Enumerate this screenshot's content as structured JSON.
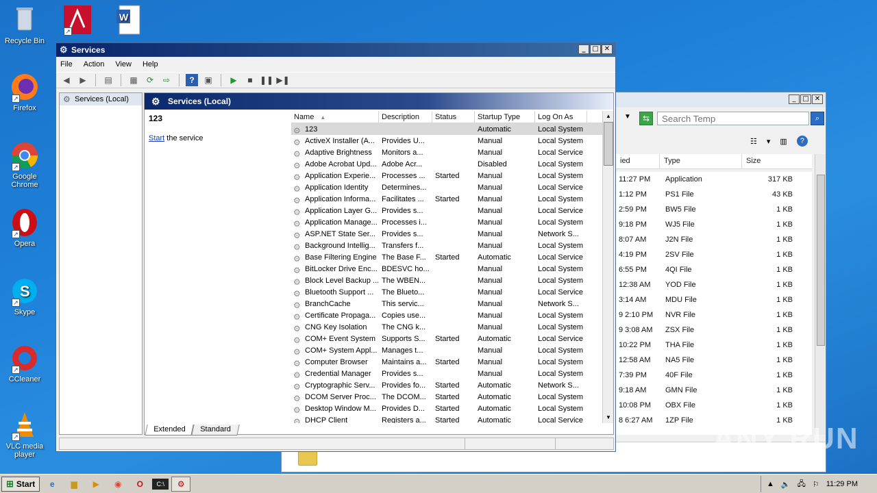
{
  "desktop": {
    "icons": [
      {
        "label": "Recycle Bin"
      },
      {
        "label": ""
      },
      {
        "label": ""
      },
      {
        "label": "Firefox"
      },
      {
        "label": "Google Chrome"
      },
      {
        "label": "Opera"
      },
      {
        "label": "Skype"
      },
      {
        "label": "CCleaner"
      },
      {
        "label": "VLC media player"
      }
    ]
  },
  "explorer": {
    "search_placeholder": "Search Temp",
    "columns": [
      "ied",
      "Type",
      "Size"
    ],
    "rows": [
      {
        "d": "11:27 PM",
        "t": "Application",
        "s": "317 KB"
      },
      {
        "d": "1:12 PM",
        "t": "PS1 File",
        "s": "43 KB"
      },
      {
        "d": "2:59 PM",
        "t": "BW5 File",
        "s": "1 KB"
      },
      {
        "d": "9:18 PM",
        "t": "WJ5 File",
        "s": "1 KB"
      },
      {
        "d": "8:07 AM",
        "t": "J2N File",
        "s": "1 KB"
      },
      {
        "d": "4:19 PM",
        "t": "2SV File",
        "s": "1 KB"
      },
      {
        "d": "6:55 PM",
        "t": "4QI File",
        "s": "1 KB"
      },
      {
        "d": "12:38 AM",
        "t": "YOD File",
        "s": "1 KB"
      },
      {
        "d": "3:14 AM",
        "t": "MDU File",
        "s": "1 KB"
      },
      {
        "d": "9 2:10 PM",
        "t": "NVR File",
        "s": "1 KB"
      },
      {
        "d": "9 3:08 AM",
        "t": "ZSX File",
        "s": "1 KB"
      },
      {
        "d": "10:22 PM",
        "t": "THA File",
        "s": "1 KB"
      },
      {
        "d": "12:58 AM",
        "t": "NA5 File",
        "s": "1 KB"
      },
      {
        "d": "7:39 PM",
        "t": "40F File",
        "s": "1 KB"
      },
      {
        "d": "9:18 AM",
        "t": "GMN File",
        "s": "1 KB"
      },
      {
        "d": "10:08 PM",
        "t": "OBX File",
        "s": "1 KB"
      },
      {
        "d": "8 6:27 AM",
        "t": "1ZP File",
        "s": "1 KB"
      }
    ]
  },
  "services": {
    "title": "Services",
    "menu": [
      "File",
      "Action",
      "View",
      "Help"
    ],
    "tree_node": "Services (Local)",
    "header": "Services (Local)",
    "selected_name": "123",
    "start_link": "Start",
    "start_rest": " the service",
    "columns": [
      "Name",
      "Description",
      "Status",
      "Startup Type",
      "Log On As"
    ],
    "rows": [
      [
        "123",
        "",
        "",
        "Automatic",
        "Local System"
      ],
      [
        "ActiveX Installer (A...",
        "Provides U...",
        "",
        "Manual",
        "Local System"
      ],
      [
        "Adaptive Brightness",
        "Monitors a...",
        "",
        "Manual",
        "Local Service"
      ],
      [
        "Adobe Acrobat Upd...",
        "Adobe Acr...",
        "",
        "Disabled",
        "Local System"
      ],
      [
        "Application Experie...",
        "Processes ...",
        "Started",
        "Manual",
        "Local System"
      ],
      [
        "Application Identity",
        "Determines...",
        "",
        "Manual",
        "Local Service"
      ],
      [
        "Application Informa...",
        "Facilitates ...",
        "Started",
        "Manual",
        "Local System"
      ],
      [
        "Application Layer G...",
        "Provides s...",
        "",
        "Manual",
        "Local Service"
      ],
      [
        "Application Manage...",
        "Processes i...",
        "",
        "Manual",
        "Local System"
      ],
      [
        "ASP.NET State Ser...",
        "Provides s...",
        "",
        "Manual",
        "Network S..."
      ],
      [
        "Background Intellig...",
        "Transfers f...",
        "",
        "Manual",
        "Local System"
      ],
      [
        "Base Filtering Engine",
        "The Base F...",
        "Started",
        "Automatic",
        "Local Service"
      ],
      [
        "BitLocker Drive Enc...",
        "BDESVC ho...",
        "",
        "Manual",
        "Local System"
      ],
      [
        "Block Level Backup ...",
        "The WBEN...",
        "",
        "Manual",
        "Local System"
      ],
      [
        "Bluetooth Support ...",
        "The Blueto...",
        "",
        "Manual",
        "Local Service"
      ],
      [
        "BranchCache",
        "This servic...",
        "",
        "Manual",
        "Network S..."
      ],
      [
        "Certificate Propaga...",
        "Copies use...",
        "",
        "Manual",
        "Local System"
      ],
      [
        "CNG Key Isolation",
        "The CNG k...",
        "",
        "Manual",
        "Local System"
      ],
      [
        "COM+ Event System",
        "Supports S...",
        "Started",
        "Automatic",
        "Local Service"
      ],
      [
        "COM+ System Appl...",
        "Manages t...",
        "",
        "Manual",
        "Local System"
      ],
      [
        "Computer Browser",
        "Maintains a...",
        "Started",
        "Manual",
        "Local System"
      ],
      [
        "Credential Manager",
        "Provides s...",
        "",
        "Manual",
        "Local System"
      ],
      [
        "Cryptographic Serv...",
        "Provides fo...",
        "Started",
        "Automatic",
        "Network S..."
      ],
      [
        "DCOM Server Proc...",
        "The DCOM...",
        "Started",
        "Automatic",
        "Local System"
      ],
      [
        "Desktop Window M...",
        "Provides D...",
        "Started",
        "Automatic",
        "Local System"
      ],
      [
        "DHCP Client",
        "Registers a...",
        "Started",
        "Automatic",
        "Local Service"
      ]
    ],
    "tabs": [
      "Extended",
      "Standard"
    ]
  },
  "taskbar": {
    "start": "Start",
    "clock": "11:29 PM"
  },
  "watermark": "ANY RUN"
}
